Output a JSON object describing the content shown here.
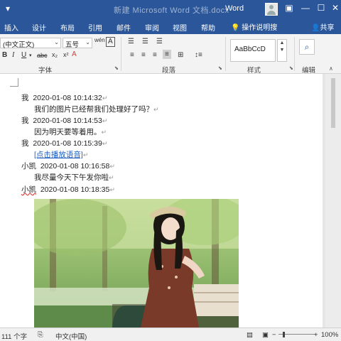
{
  "titlebar": {
    "doc_title": "新建 Microsoft Word 文档.docx",
    "app_name": "Word",
    "save_icon": "save-icon",
    "user_icon": "user-icon"
  },
  "tabs": {
    "items": [
      "插入",
      "设计",
      "布局",
      "引用",
      "邮件",
      "审阅",
      "视图",
      "帮助"
    ],
    "tell_me": "操作说明搜",
    "share": "共享"
  },
  "ribbon": {
    "font_name": "(中文正文)",
    "font_size": "五号",
    "font_group": "字体",
    "paragraph_group": "段落",
    "styles_group": "样式",
    "editing_group": "编辑",
    "styles_preview": "AaBbCcD",
    "phonetic": "wén",
    "char_border": "A",
    "bold": "B",
    "italic": "I",
    "underline": "U",
    "strike": "abc",
    "subscript": "x₂",
    "superscript": "x²"
  },
  "document": {
    "lines": [
      {
        "speaker": "我",
        "timestamp": "2020-01-08 10:14:32"
      },
      {
        "message": "我们的图片已经帮我们处理好了吗？"
      },
      {
        "speaker": "我",
        "timestamp": "2020-01-08 10:14:53"
      },
      {
        "message": "因为明天要等着用。"
      },
      {
        "speaker": "我",
        "timestamp": "2020-01-08 10:15:39"
      },
      {
        "message": "[点击播放语音]"
      },
      {
        "speaker": "小凯",
        "timestamp": "2020-01-08 10:16:58"
      },
      {
        "message": "我尽量今天下午发你啦"
      },
      {
        "speaker": "小凯",
        "timestamp": "2020-01-08 10:18:35"
      }
    ],
    "paragraph_mark": "↵"
  },
  "status": {
    "word_count": "111 个字",
    "language": "中文(中国)",
    "zoom": "100%"
  }
}
